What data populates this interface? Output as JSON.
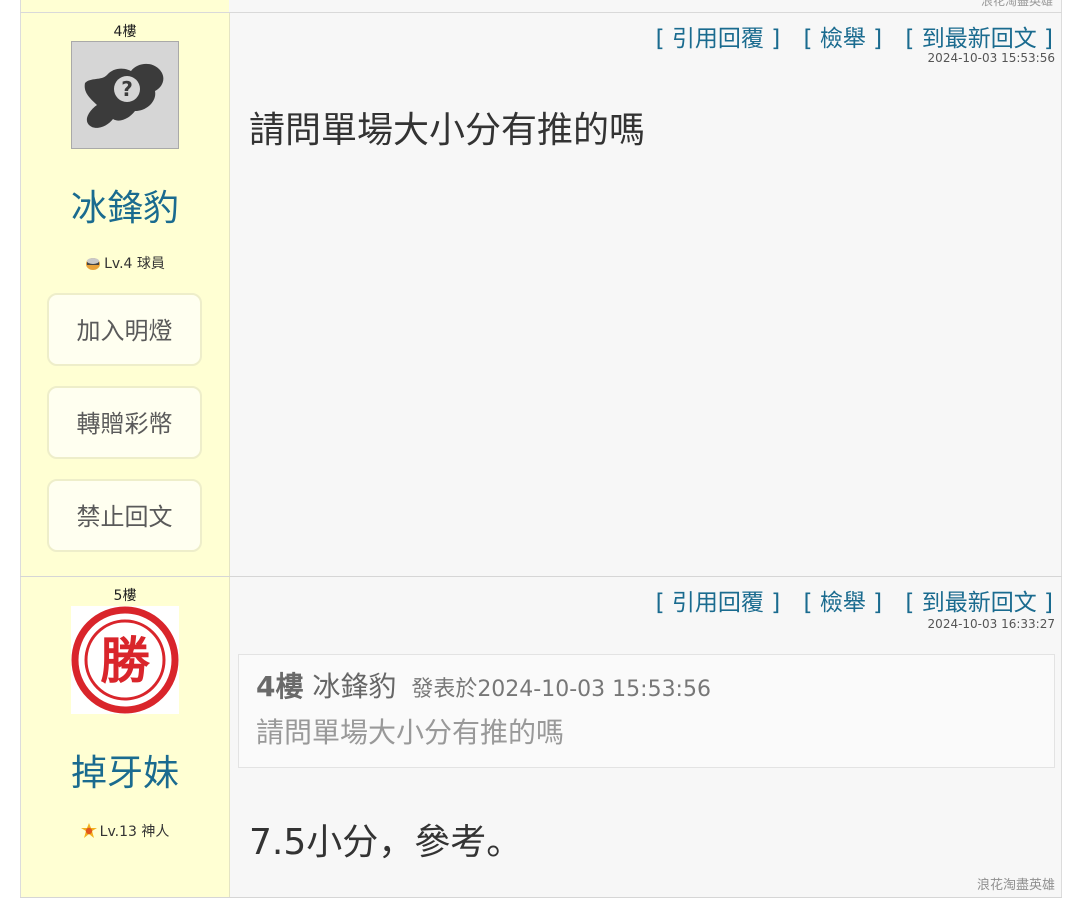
{
  "top_signature": "浪花淘盡英雄",
  "posts": [
    {
      "floor": "4樓",
      "username": "冰鋒豹",
      "level": "Lv.4 球員",
      "level_icon": "helmet-icon",
      "avatar_icon": "unknown-avatar-icon",
      "buttons": [
        "加入明燈",
        "轉贈彩幣",
        "禁止回文"
      ],
      "actions": [
        "[ 引用回覆 ]",
        "[ 檢舉 ]",
        "[ 到最新回文 ]"
      ],
      "timestamp": "2024-10-03 15:53:56",
      "content": "請問單場大小分有推的嗎"
    },
    {
      "floor": "5樓",
      "username": "掉牙妹",
      "level": "Lv.13 神人",
      "level_icon": "sun-badge-icon",
      "avatar_icon": "win-stamp-icon",
      "avatar_text": "勝",
      "actions": [
        "[ 引用回覆 ]",
        "[ 檢舉 ]",
        "[ 到最新回文 ]"
      ],
      "timestamp": "2024-10-03 16:33:27",
      "quote": {
        "floor": "4樓",
        "author": "冰鋒豹",
        "meta": "發表於2024-10-03 15:53:56",
        "text": "請問單場大小分有推的嗎"
      },
      "content": "7.5小分，參考。",
      "signature": "浪花淘盡英雄"
    }
  ],
  "colors": {
    "sidebar_bg": "#ffffd3",
    "main_bg": "#f7f7f7",
    "link": "#1a6b8f",
    "win_red": "#d9252b"
  }
}
